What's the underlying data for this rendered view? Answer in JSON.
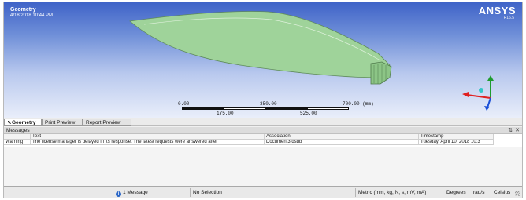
{
  "viewport": {
    "title": "Geometry",
    "timestamp": "4/18/2018 10:44 PM",
    "logo": "ANSYS",
    "version": "R16.5",
    "model_color": "#9fd39a",
    "scale": {
      "top_labels": [
        "0.00",
        "350.00",
        "700.00 (mm)"
      ],
      "bottom_labels": [
        "175.00",
        "525.00"
      ]
    },
    "triad": {
      "x_color": "#e02020",
      "y_color": "#1e9c2e",
      "z_color": "#1a4fd8"
    }
  },
  "tabs": [
    {
      "label": "Geometry",
      "active": true
    },
    {
      "label": "Print Preview",
      "active": false
    },
    {
      "label": "Report Preview",
      "active": false
    }
  ],
  "messages": {
    "title": "Messages",
    "pin_icon": "pin-icon",
    "close_icon": "close-icon",
    "columns": [
      "Text",
      "Association",
      "Timestamp"
    ],
    "rows": [
      {
        "type": "Warning",
        "text": "The license manager is delayed in its response. The latest requests were answered after",
        "association": "Document3.dsdb",
        "timestamp": "Tuesday, April 10, 2018 10:3"
      }
    ]
  },
  "status_bar": {
    "messages": "1 Message",
    "selection": "No Selection",
    "units": "Metric (mm, kg, N, s, mV, mA)",
    "angle": "Degrees",
    "rotation": "rad/s",
    "temperature": "Celsius"
  }
}
